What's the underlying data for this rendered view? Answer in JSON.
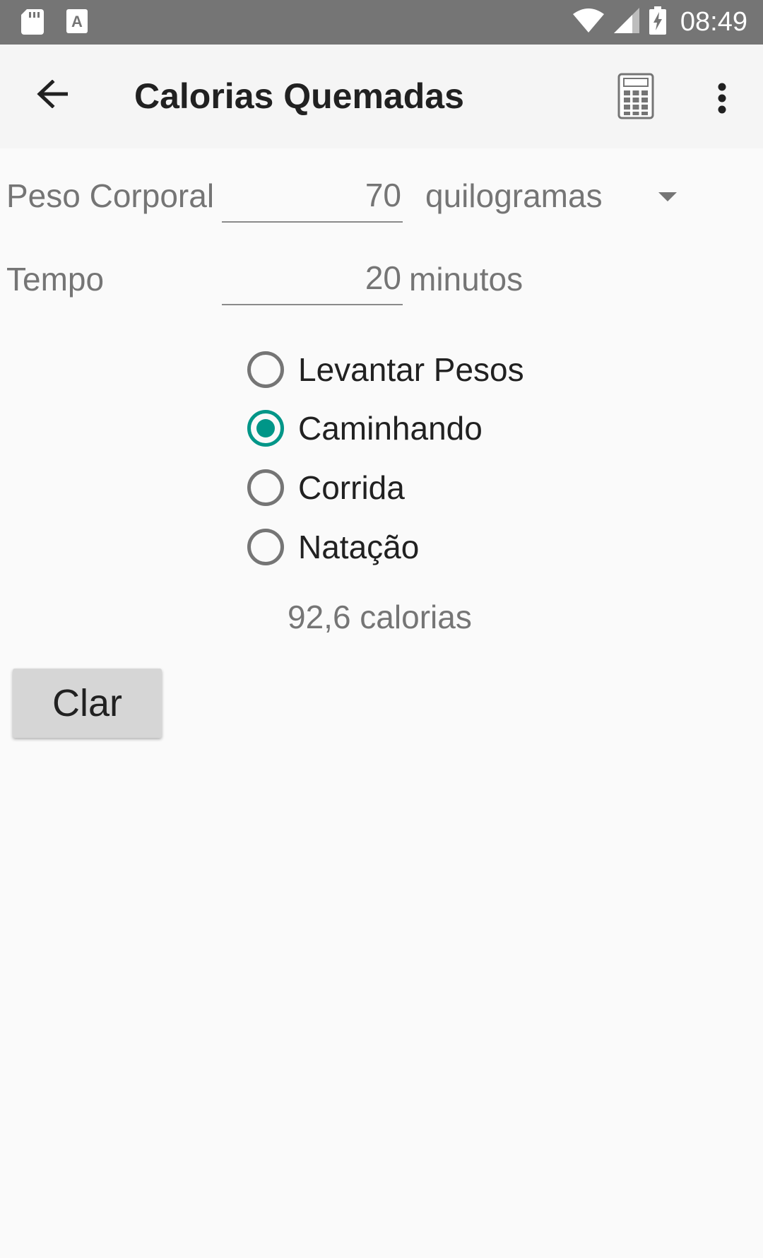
{
  "status_bar": {
    "time": "08:49",
    "icons": [
      "sd-card-icon",
      "a-text-icon",
      "wifi-icon",
      "signal-icon",
      "battery-charging-icon"
    ]
  },
  "app_bar": {
    "title": "Calorias Quemadas",
    "icons": [
      "back-arrow-icon",
      "calculator-icon",
      "more-vertical-icon"
    ]
  },
  "form": {
    "weight_label": "Peso Corporal",
    "weight_value": "70",
    "weight_unit": "quilogramas",
    "time_label": "Tempo",
    "time_value": "20",
    "time_unit": "minutos"
  },
  "activities": [
    {
      "label": "Levantar Pesos",
      "checked": false
    },
    {
      "label": "Caminhando",
      "checked": true
    },
    {
      "label": "Corrida",
      "checked": false
    },
    {
      "label": "Natação",
      "checked": false
    }
  ],
  "result": "92,6 calorias",
  "clear_button": "Clar",
  "colors": {
    "accent": "#009688",
    "status_bar": "#757575",
    "app_bar": "#f5f5f5",
    "background": "#fafafa"
  }
}
